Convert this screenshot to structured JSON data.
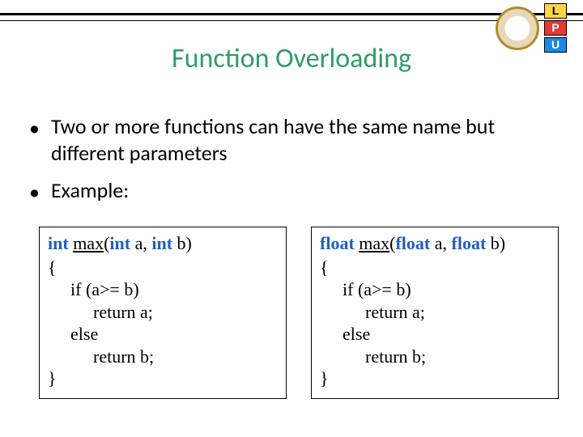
{
  "title": "Function Overloading",
  "bullets": [
    "Two or more functions can have the same name but different parameters",
    "Example:"
  ],
  "code": {
    "left": {
      "ret_kw": "int",
      "fn": "max",
      "p1_kw": "int",
      "p1_name": "a",
      "p2_kw": "int",
      "p2_name": "b",
      "b_open": "{",
      "l_if": "if (a>= b)",
      "l_ret_a": "return a;",
      "l_else": "else",
      "l_ret_b": "return b;",
      "b_close": "}"
    },
    "right": {
      "ret_kw": "float",
      "fn": "max",
      "p1_kw": "float",
      "p1_name": "a",
      "p2_kw": "float",
      "p2_name": "b",
      "b_open": "{",
      "l_if": "if (a>= b)",
      "l_ret_a": "return a;",
      "l_else": "else",
      "l_ret_b": "return b;",
      "b_close": "}"
    }
  },
  "logo": {
    "L": "L",
    "P": "P",
    "U": "U"
  }
}
